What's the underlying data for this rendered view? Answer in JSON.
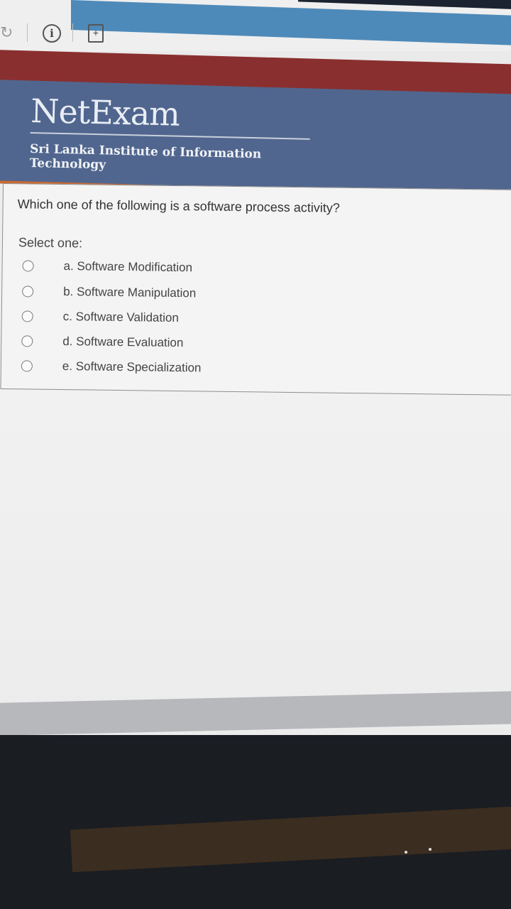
{
  "browser": {
    "icons": [
      "reload-icon",
      "info-icon",
      "page-icon"
    ],
    "info_glyph": "i",
    "page_glyph": "+"
  },
  "header": {
    "title": "NetExam",
    "subtitle": "Sri Lanka Institute of Information Technology"
  },
  "question": {
    "text": "Which one of the following is a software process activity?",
    "select_label": "Select one:",
    "options": [
      {
        "label": "a. Software Modification"
      },
      {
        "label": "b. Software Manipulation"
      },
      {
        "label": "c. Software Validation"
      },
      {
        "label": "d. Software Evaluation"
      },
      {
        "label": "e. Software Specialization"
      }
    ]
  },
  "colors": {
    "header_blue": "#51668e",
    "header_red": "#8a2f2f",
    "accent_orange": "#c96b33"
  }
}
